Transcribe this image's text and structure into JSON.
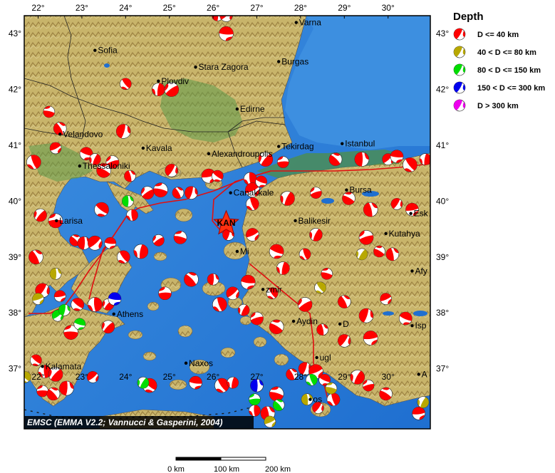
{
  "map": {
    "credit": "EMSC (EMMA V2.2; Vannucci & Gasperini, 2004)",
    "epicenter_label": "KAN",
    "epicenter": {
      "lon": 26.3,
      "lat": 39.6
    },
    "lon_ticks": [
      "22°",
      "23°",
      "24°",
      "25°",
      "26°",
      "27°",
      "28°",
      "29°",
      "30°"
    ],
    "lat_ticks": [
      "43°",
      "42°",
      "41°",
      "40°",
      "39°",
      "38°",
      "37°"
    ],
    "cities": [
      {
        "name": "Varna",
        "lon": 27.9,
        "lat": 43.2
      },
      {
        "name": "Sofia",
        "lon": 23.3,
        "lat": 42.7
      },
      {
        "name": "Stara Zagora",
        "lon": 25.6,
        "lat": 42.4
      },
      {
        "name": "Burgas",
        "lon": 27.5,
        "lat": 42.5
      },
      {
        "name": "Plovdiv",
        "lon": 24.75,
        "lat": 42.15
      },
      {
        "name": "Edirne",
        "lon": 26.55,
        "lat": 41.65
      },
      {
        "name": "Velandovo",
        "lon": 22.5,
        "lat": 41.2
      },
      {
        "name": "Kavala",
        "lon": 24.4,
        "lat": 40.95
      },
      {
        "name": "Alexandroupolis",
        "lon": 25.9,
        "lat": 40.85
      },
      {
        "name": "Tekirdag",
        "lon": 27.5,
        "lat": 40.98
      },
      {
        "name": "Istanbul",
        "lon": 28.95,
        "lat": 41.03
      },
      {
        "name": "Thessaloniki",
        "lon": 22.95,
        "lat": 40.63
      },
      {
        "name": "Canakkale",
        "lon": 26.4,
        "lat": 40.15
      },
      {
        "name": "Bursa",
        "lon": 29.05,
        "lat": 40.2
      },
      {
        "name": "Esk",
        "lon": 30.52,
        "lat": 39.78
      },
      {
        "name": "Larisa",
        "lon": 22.42,
        "lat": 39.65
      },
      {
        "name": "Balikesir",
        "lon": 27.88,
        "lat": 39.65
      },
      {
        "name": "Kutahya",
        "lon": 29.95,
        "lat": 39.42
      },
      {
        "name": "Mi",
        "lon": 26.55,
        "lat": 39.1
      },
      {
        "name": "Afy",
        "lon": 30.55,
        "lat": 38.75
      },
      {
        "name": "zmir",
        "lon": 27.14,
        "lat": 38.42
      },
      {
        "name": "Athens",
        "lon": 23.73,
        "lat": 37.98
      },
      {
        "name": "Aydin",
        "lon": 27.84,
        "lat": 37.85
      },
      {
        "name": "D",
        "lon": 28.9,
        "lat": 37.8
      },
      {
        "name": "Isp",
        "lon": 30.55,
        "lat": 37.77
      },
      {
        "name": "Kalamata",
        "lon": 22.1,
        "lat": 37.04
      },
      {
        "name": "Naxos",
        "lon": 25.38,
        "lat": 37.1
      },
      {
        "name": "ugl",
        "lon": 28.37,
        "lat": 37.2
      },
      {
        "name": "A",
        "lon": 30.7,
        "lat": 36.9
      },
      {
        "name": "os",
        "lon": 28.22,
        "lat": 36.45
      }
    ],
    "mechanisms": [
      {
        "lon": 26.1,
        "lat": 43.33
      },
      {
        "lon": 26.3,
        "lat": 43.33
      },
      {
        "lon": 26.3,
        "lat": 43.0
      },
      {
        "lon": 24.0,
        "lat": 42.1
      },
      {
        "lon": 24.75,
        "lat": 42.0
      },
      {
        "lon": 25.05,
        "lat": 42.0
      },
      {
        "lon": 22.25,
        "lat": 41.6
      },
      {
        "lon": 22.5,
        "lat": 41.3
      },
      {
        "lon": 23.95,
        "lat": 41.25
      },
      {
        "lon": 22.4,
        "lat": 40.95
      },
      {
        "lon": 23.1,
        "lat": 40.85
      },
      {
        "lon": 21.9,
        "lat": 40.7
      },
      {
        "lon": 23.3,
        "lat": 40.75
      },
      {
        "lon": 23.7,
        "lat": 40.7
      },
      {
        "lon": 23.5,
        "lat": 40.55
      },
      {
        "lon": 24.1,
        "lat": 40.45
      },
      {
        "lon": 25.05,
        "lat": 40.55
      },
      {
        "lon": 25.9,
        "lat": 40.45
      },
      {
        "lon": 26.1,
        "lat": 40.45
      },
      {
        "lon": 26.85,
        "lat": 40.4
      },
      {
        "lon": 27.2,
        "lat": 40.75
      },
      {
        "lon": 27.6,
        "lat": 40.7
      },
      {
        "lon": 28.8,
        "lat": 40.75
      },
      {
        "lon": 29.4,
        "lat": 40.75
      },
      {
        "lon": 30.0,
        "lat": 40.75
      },
      {
        "lon": 30.2,
        "lat": 40.8
      },
      {
        "lon": 30.5,
        "lat": 40.65
      },
      {
        "lon": 30.85,
        "lat": 40.75
      },
      {
        "lon": 24.5,
        "lat": 40.15
      },
      {
        "lon": 24.8,
        "lat": 40.2
      },
      {
        "lon": 25.2,
        "lat": 40.15
      },
      {
        "lon": 25.5,
        "lat": 40.15
      },
      {
        "lon": 26.9,
        "lat": 40.2
      },
      {
        "lon": 27.1,
        "lat": 40.35
      },
      {
        "lon": 26.9,
        "lat": 39.95
      },
      {
        "lon": 27.7,
        "lat": 40.05
      },
      {
        "lon": 28.35,
        "lat": 40.15
      },
      {
        "lon": 29.1,
        "lat": 40.05
      },
      {
        "lon": 29.6,
        "lat": 39.85
      },
      {
        "lon": 30.2,
        "lat": 39.95
      },
      {
        "lon": 30.55,
        "lat": 39.85
      },
      {
        "lon": 23.45,
        "lat": 39.85
      },
      {
        "lon": 24.15,
        "lat": 39.75
      },
      {
        "lon": 22.05,
        "lat": 39.75
      },
      {
        "lon": 22.4,
        "lat": 39.65
      },
      {
        "lon": 22.85,
        "lat": 39.3
      },
      {
        "lon": 23.05,
        "lat": 39.25
      },
      {
        "lon": 23.3,
        "lat": 39.25
      },
      {
        "lon": 23.65,
        "lat": 39.25
      },
      {
        "lon": 23.95,
        "lat": 39.0
      },
      {
        "lon": 24.35,
        "lat": 39.1
      },
      {
        "lon": 24.75,
        "lat": 39.3
      },
      {
        "lon": 25.25,
        "lat": 39.35
      },
      {
        "lon": 21.95,
        "lat": 39.0
      },
      {
        "lon": 26.35,
        "lat": 39.4
      },
      {
        "lon": 26.9,
        "lat": 39.4
      },
      {
        "lon": 27.45,
        "lat": 39.1
      },
      {
        "lon": 28.1,
        "lat": 39.05
      },
      {
        "lon": 28.35,
        "lat": 39.4
      },
      {
        "lon": 29.5,
        "lat": 39.35
      },
      {
        "lon": 29.8,
        "lat": 39.1
      },
      {
        "lon": 30.1,
        "lat": 39.05
      },
      {
        "lon": 22.1,
        "lat": 38.4
      },
      {
        "lon": 22.5,
        "lat": 38.3
      },
      {
        "lon": 22.9,
        "lat": 38.15
      },
      {
        "lon": 23.3,
        "lat": 38.15
      },
      {
        "lon": 23.6,
        "lat": 38.15
      },
      {
        "lon": 24.9,
        "lat": 38.35
      },
      {
        "lon": 25.5,
        "lat": 38.6
      },
      {
        "lon": 26.0,
        "lat": 38.6
      },
      {
        "lon": 26.45,
        "lat": 38.35
      },
      {
        "lon": 26.8,
        "lat": 38.55
      },
      {
        "lon": 27.35,
        "lat": 38.35
      },
      {
        "lon": 27.6,
        "lat": 38.8
      },
      {
        "lon": 28.1,
        "lat": 38.15
      },
      {
        "lon": 28.6,
        "lat": 38.7
      },
      {
        "lon": 29.0,
        "lat": 38.2
      },
      {
        "lon": 29.5,
        "lat": 37.95
      },
      {
        "lon": 29.95,
        "lat": 38.25
      },
      {
        "lon": 30.4,
        "lat": 37.9
      },
      {
        "lon": 26.15,
        "lat": 38.15
      },
      {
        "lon": 26.7,
        "lat": 38.05
      },
      {
        "lon": 27.0,
        "lat": 37.9
      },
      {
        "lon": 27.45,
        "lat": 37.75
      },
      {
        "lon": 28.5,
        "lat": 37.7
      },
      {
        "lon": 29.0,
        "lat": 37.5
      },
      {
        "lon": 29.6,
        "lat": 37.55
      },
      {
        "lon": 21.95,
        "lat": 37.15
      },
      {
        "lon": 22.15,
        "lat": 36.95
      },
      {
        "lon": 22.4,
        "lat": 36.9
      },
      {
        "lon": 22.1,
        "lat": 36.6
      },
      {
        "lon": 22.35,
        "lat": 36.55
      },
      {
        "lon": 22.65,
        "lat": 36.65
      },
      {
        "lon": 23.25,
        "lat": 36.85
      },
      {
        "lon": 25.6,
        "lat": 36.75
      },
      {
        "lon": 26.2,
        "lat": 36.7
      },
      {
        "lon": 26.45,
        "lat": 36.75
      },
      {
        "lon": 27.0,
        "lat": 36.7
      },
      {
        "lon": 27.45,
        "lat": 36.55
      },
      {
        "lon": 27.8,
        "lat": 36.9
      },
      {
        "lon": 28.1,
        "lat": 37.0
      },
      {
        "lon": 28.35,
        "lat": 36.95
      },
      {
        "lon": 28.55,
        "lat": 36.8
      },
      {
        "lon": 28.75,
        "lat": 36.45
      },
      {
        "lon": 29.3,
        "lat": 36.85
      },
      {
        "lon": 29.55,
        "lat": 36.7
      },
      {
        "lon": 29.95,
        "lat": 36.55
      },
      {
        "lon": 27.25,
        "lat": 36.2
      },
      {
        "lon": 28.4,
        "lat": 36.3
      },
      {
        "lon": 30.7,
        "lat": 36.2
      },
      {
        "lon": 24.55,
        "lat": 36.7
      },
      {
        "lon": 26.95,
        "lat": 36.25
      },
      {
        "lon": 23.6,
        "lat": 37.75
      },
      {
        "lon": 22.75,
        "lat": 37.65
      }
    ],
    "mechanisms_intermediate": [
      {
        "lon": 22.4,
        "lat": 38.7
      },
      {
        "lon": 22.0,
        "lat": 38.25
      },
      {
        "lon": 28.45,
        "lat": 38.45
      },
      {
        "lon": 29.4,
        "lat": 39.05
      },
      {
        "lon": 28.7,
        "lat": 36.65
      },
      {
        "lon": 28.15,
        "lat": 36.45
      },
      {
        "lon": 27.3,
        "lat": 36.05
      },
      {
        "lon": 21.7,
        "lat": 36.85
      },
      {
        "lon": 30.8,
        "lat": 36.4
      }
    ],
    "mechanisms_deep": [
      {
        "lon": 24.05,
        "lat": 40.0
      },
      {
        "lon": 22.45,
        "lat": 37.95
      },
      {
        "lon": 22.95,
        "lat": 37.8
      },
      {
        "lon": 28.25,
        "lat": 36.8
      },
      {
        "lon": 24.4,
        "lat": 36.75
      },
      {
        "lon": 26.95,
        "lat": 36.45
      },
      {
        "lon": 27.5,
        "lat": 36.35
      },
      {
        "lon": 22.6,
        "lat": 38.05
      }
    ],
    "mechanisms_subcrustal": [
      {
        "lon": 27.0,
        "lat": 36.7
      },
      {
        "lon": 23.75,
        "lat": 38.25
      }
    ]
  },
  "legend": {
    "title": "Depth",
    "items": [
      {
        "label": "D <= 40 km",
        "color": "#ff0000"
      },
      {
        "label": "40 < D <= 80 km",
        "color": "#b8a800"
      },
      {
        "label": "80 < D <= 150 km",
        "color": "#00dd00"
      },
      {
        "label": "150 < D <= 300 km",
        "color": "#0000ee"
      },
      {
        "label": "D > 300 km",
        "color": "#ee00ee"
      }
    ]
  },
  "scale_bar": {
    "labels": [
      "0 km",
      "100 km",
      "200 km"
    ]
  }
}
